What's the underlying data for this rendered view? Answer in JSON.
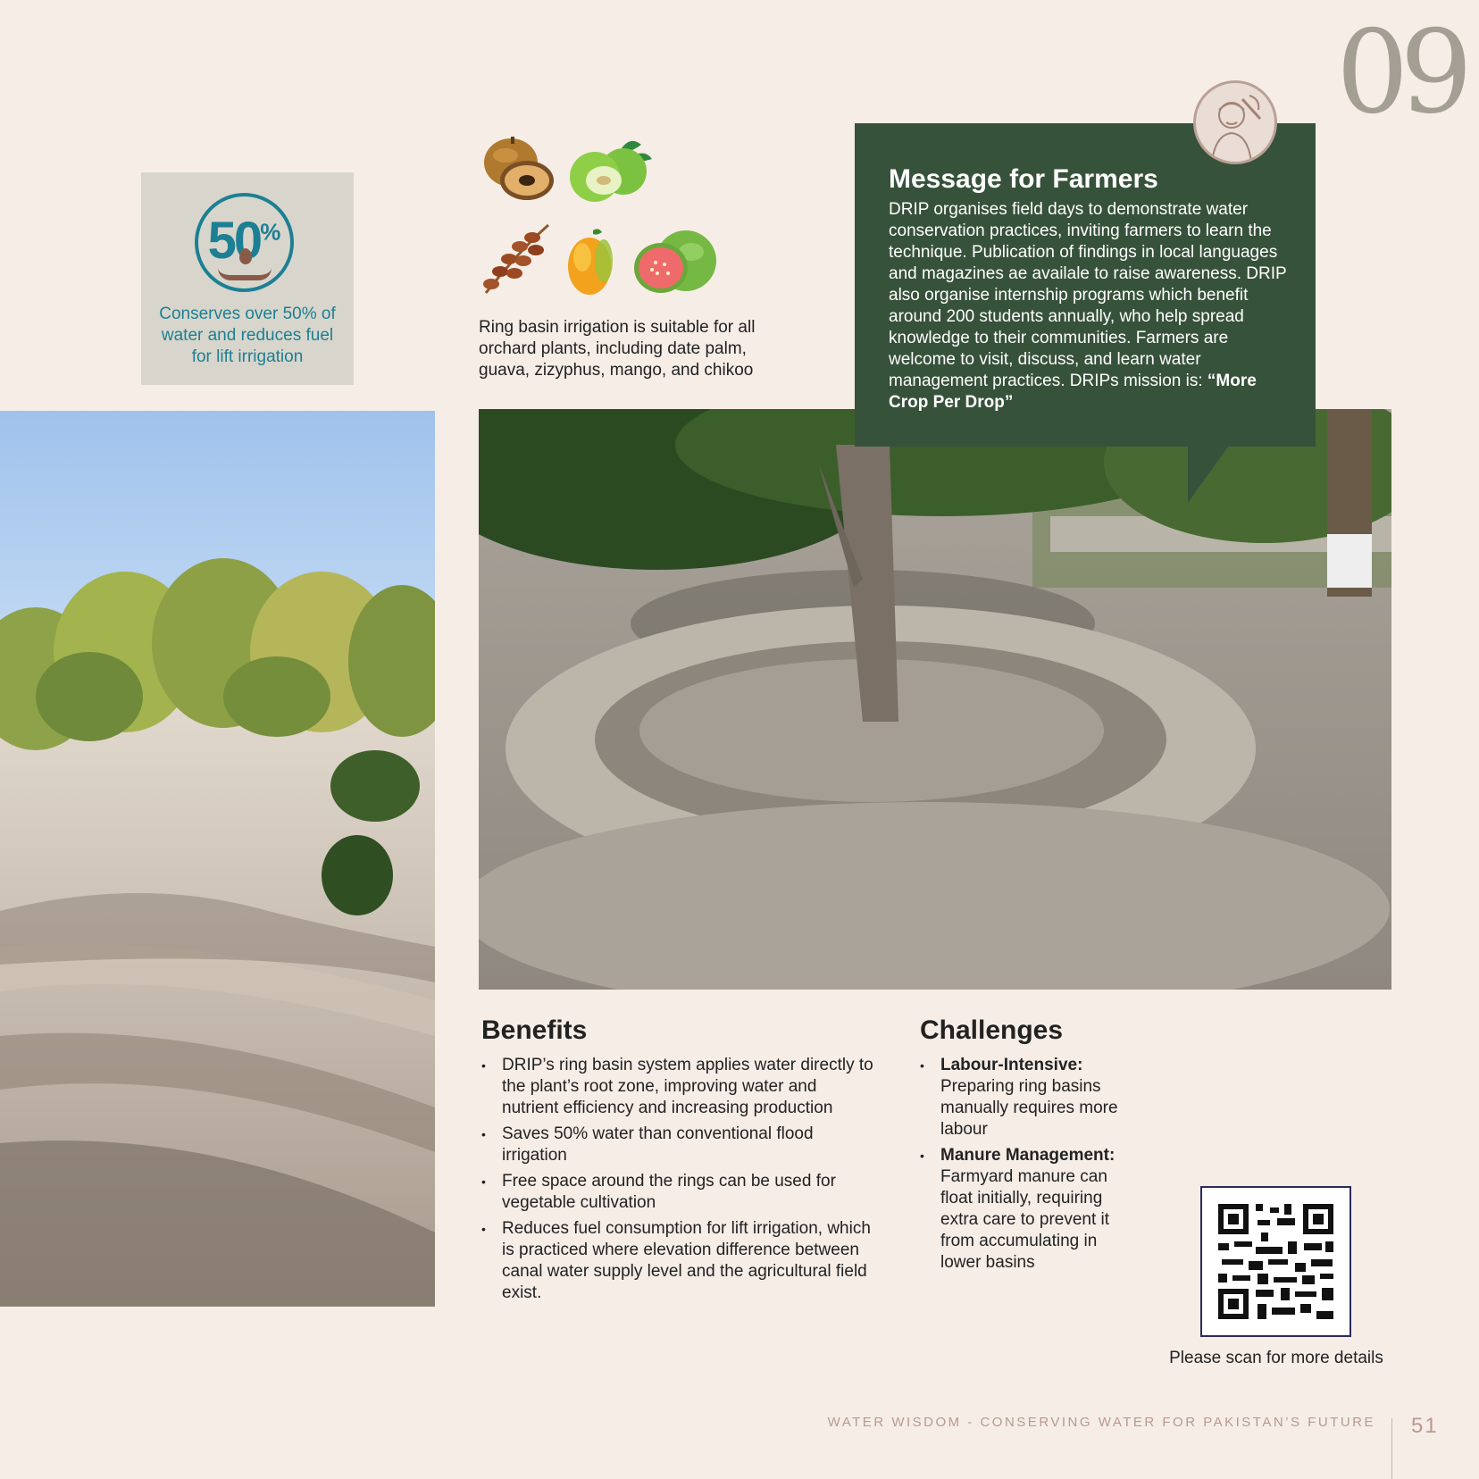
{
  "chapter_number": "09",
  "stat": {
    "value": "50",
    "unit": "%",
    "description": "Conserves over 50% of water and reduces fuel for lift irrigation",
    "icon": "water-drop-hand-icon",
    "color": "#1d7f93"
  },
  "fruits": {
    "icons": [
      "chikoo-icon",
      "ber-icon",
      "dates-icon",
      "mango-icon",
      "guava-icon"
    ],
    "caption": "Ring basin irrigation is suitable for all orchard plants, including date palm, guava, zizyphus, mango, and chikoo"
  },
  "message": {
    "title": "Message for Farmers",
    "body": "DRIP organises field days to demonstrate water conservation practices, inviting farmers to learn the technique. Publication of findings in local languages and magazines ae availale to raise awareness. DRIP also organise internship programs which benefit around 200 students annually, who help spread knowledge to their communities. Farmers are welcome to visit, discuss, and learn water management practices. DRIPs mission is: ",
    "mission": "“More Crop Per Drop”",
    "badge_icon": "farmer-icon",
    "color": "#37523b"
  },
  "benefits": {
    "title": "Benefits",
    "items": [
      "DRIP’s ring basin system applies water directly to the plant’s root zone, improving water and nutrient efficiency and increasing production",
      "Saves 50% water than conventional flood irrigation",
      "Free space around the rings can be used for vegetable cultivation",
      "Reduces fuel consumption for lift irrigation, which is practiced where elevation difference between canal water supply level and the agricultural field exist."
    ]
  },
  "challenges": {
    "title": "Challenges",
    "items": [
      {
        "head": "Labour-Intensive:",
        "text": "Preparing ring basins manually requires more labour"
      },
      {
        "head": "Manure Management:",
        "text": "Farmyard manure can float initially, requiring extra care to prevent it from accumulating in lower basins"
      }
    ]
  },
  "qr": {
    "icon": "qr-code-icon",
    "caption": "Please scan for more details"
  },
  "footer": {
    "text": "WATER WISDOM - CONSERVING WATER FOR PAKISTAN’S FUTURE",
    "page": "51"
  }
}
